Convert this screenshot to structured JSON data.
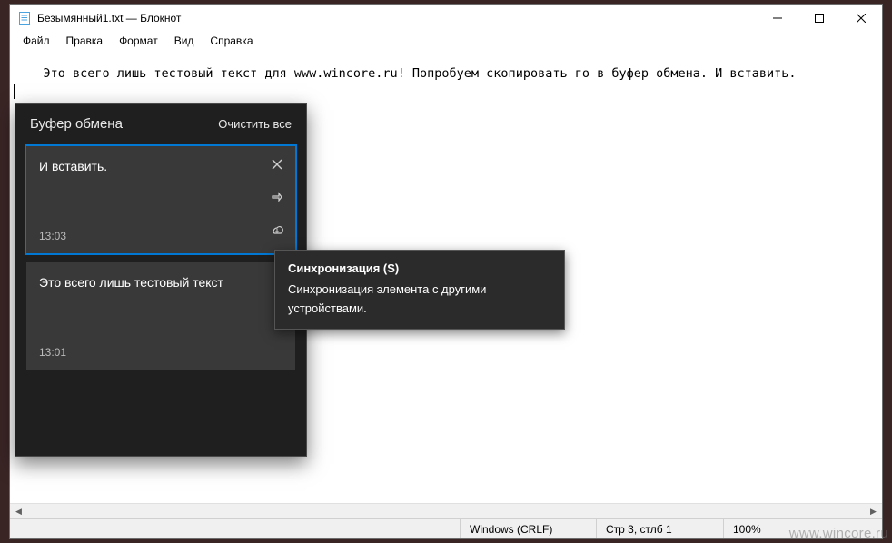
{
  "window": {
    "title": "Безымянный1.txt — Блокнот"
  },
  "menu": {
    "file": "Файл",
    "edit": "Правка",
    "format": "Формат",
    "view": "Вид",
    "help": "Справка"
  },
  "editor": {
    "content": "Это всего лишь тестовый текст для www.wincore.ru! Попробуем скопировать го в буфер обмена. И вставить."
  },
  "statusbar": {
    "linebreak": "Windows (CRLF)",
    "caret": "Стр 3, стлб 1",
    "zoom": "100%"
  },
  "clipboard": {
    "title": "Буфер обмена",
    "clear_all": "Очистить все",
    "items": [
      {
        "text": "И вставить.",
        "time": "13:03",
        "selected": true,
        "show_actions": true
      },
      {
        "text": "Это всего лишь тестовый текст",
        "time": "13:01",
        "selected": false,
        "show_actions": false
      }
    ]
  },
  "tooltip": {
    "title": "Синхронизация (S)",
    "body": "Синхронизация элемента с другими устройствами."
  },
  "watermark": "www.wincore.ru"
}
